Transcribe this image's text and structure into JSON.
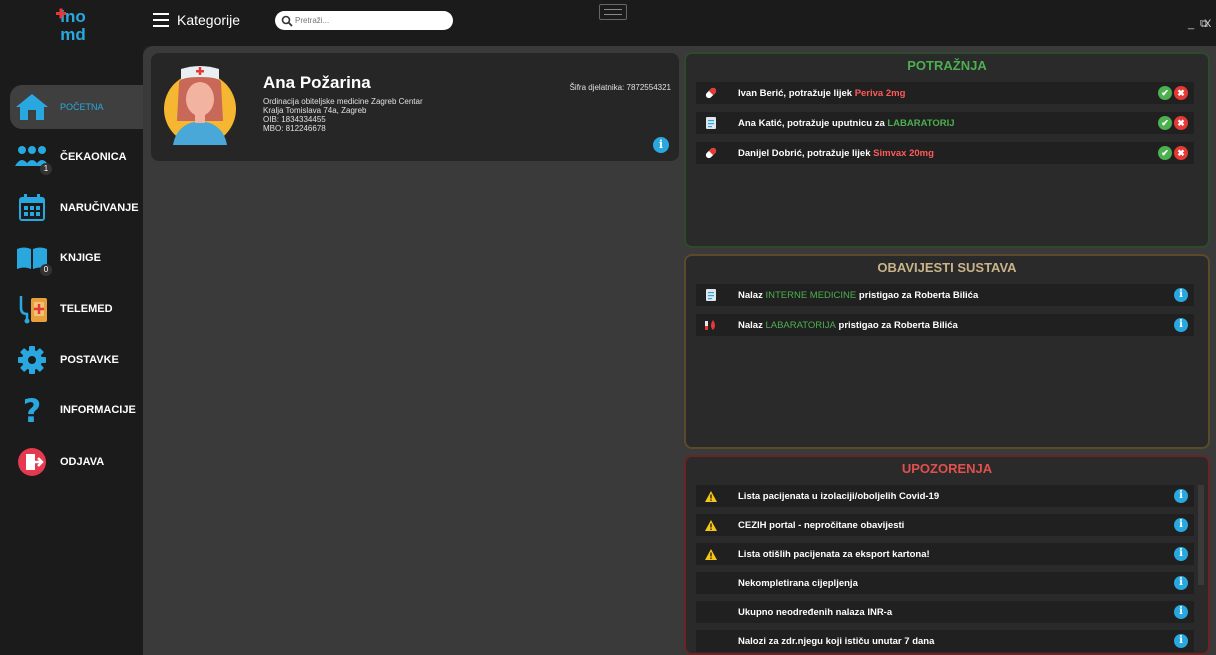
{
  "topbar": {
    "category_label": "Kategorije",
    "search_placeholder": "Pretraži...",
    "window_controls": {
      "minimize": "_",
      "restore": "⧉",
      "close": "X"
    }
  },
  "sidebar": {
    "items": [
      {
        "label": "POČETNA",
        "icon": "home-icon",
        "active": true
      },
      {
        "label": "ČEKAONICA",
        "icon": "people-icon",
        "badge": "1"
      },
      {
        "label": "NARUČIVANJE",
        "icon": "calendar-icon"
      },
      {
        "label": "KNJIGE",
        "icon": "book-icon",
        "badge": "0"
      },
      {
        "label": "TELEMED",
        "icon": "telemed-icon"
      },
      {
        "label": "POSTAVKE",
        "icon": "gear-icon"
      },
      {
        "label": "INFORMACIJE",
        "icon": "question-icon"
      },
      {
        "label": "ODJAVA",
        "icon": "logout-icon"
      }
    ]
  },
  "profile": {
    "name": "Ana Požarina",
    "practice": "Ordinacija obiteljske medicine Zagreb Centar",
    "address": "Kralja Tomislava 74a, Zagreb",
    "oib": "OIB: 1834334455",
    "mbo": "MBO: 812246678",
    "code": "Šifra djelatnika: 7872554321"
  },
  "potraznja": {
    "title": "POTRAŽNJA",
    "rows": [
      {
        "icon": "pill-icon",
        "text": "Ivan Berić, potražuje lijek ",
        "highlight": "Periva 2mg",
        "hl_color": "red"
      },
      {
        "icon": "document-icon",
        "text": "Ana Katić, potražuje uputnicu za ",
        "highlight": "LABARATORIJ",
        "hl_color": "green"
      },
      {
        "icon": "pill-icon",
        "text": "Danijel Dobrić, potražuje lijek ",
        "highlight": "Simvax 20mg",
        "hl_color": "red"
      }
    ]
  },
  "obavijesti": {
    "title": "OBAVIJESTI SUSTAVA",
    "rows": [
      {
        "icon": "document-icon",
        "pre": "Nalaz ",
        "highlight": "INTERNE MEDICINE",
        "post": " pristigao za ",
        "name": "Roberta Bilića"
      },
      {
        "icon": "lab-icon",
        "pre": "Nalaz ",
        "highlight": "LABARATORIJA",
        "post": " pristigao za ",
        "name": "Roberta Bilića"
      }
    ]
  },
  "upozorenja": {
    "title": "UPOZORENJA",
    "rows": [
      {
        "warn": true,
        "text": "Lista pacijenata u izolaciji/oboljelih Covid-19"
      },
      {
        "warn": true,
        "text": "CEZIH portal - nepročitane obavijesti"
      },
      {
        "warn": true,
        "text": "Lista otišlih pacijenata za eksport kartona!"
      },
      {
        "warn": false,
        "text": "Nekompletirana cijepljenja"
      },
      {
        "warn": false,
        "text": "Ukupno neodređenih nalaza INR-a"
      },
      {
        "warn": false,
        "text": "Nalozi za zdr.njegu koji ističu unutar 7 dana"
      }
    ]
  },
  "colors": {
    "accent": "#29a8e0",
    "potraznja_border": "#2e4a2e",
    "obavijesti_border": "#5a4a2a",
    "upozorenja_border": "#6a2424"
  }
}
